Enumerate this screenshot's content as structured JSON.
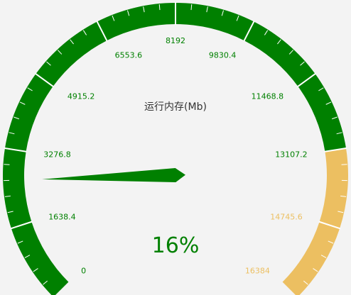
{
  "chart_data": {
    "type": "gauge",
    "title": "运行内存(Mb)",
    "min": 0,
    "max": 16384,
    "value": 2621.44,
    "percent_label": "16%",
    "tick_labels": [
      "0",
      "1638.4",
      "3276.8",
      "4915.2",
      "6553.6",
      "8192",
      "9830.4",
      "11468.8",
      "13107.2",
      "14745.6",
      "16384"
    ],
    "bands": [
      {
        "to_fraction": 0.8,
        "color": "#008000"
      },
      {
        "to_fraction": 1.0,
        "color": "#ecbf61"
      }
    ],
    "pointer_color": "#008000",
    "value_color": "#008000",
    "title_color": "#333333"
  }
}
